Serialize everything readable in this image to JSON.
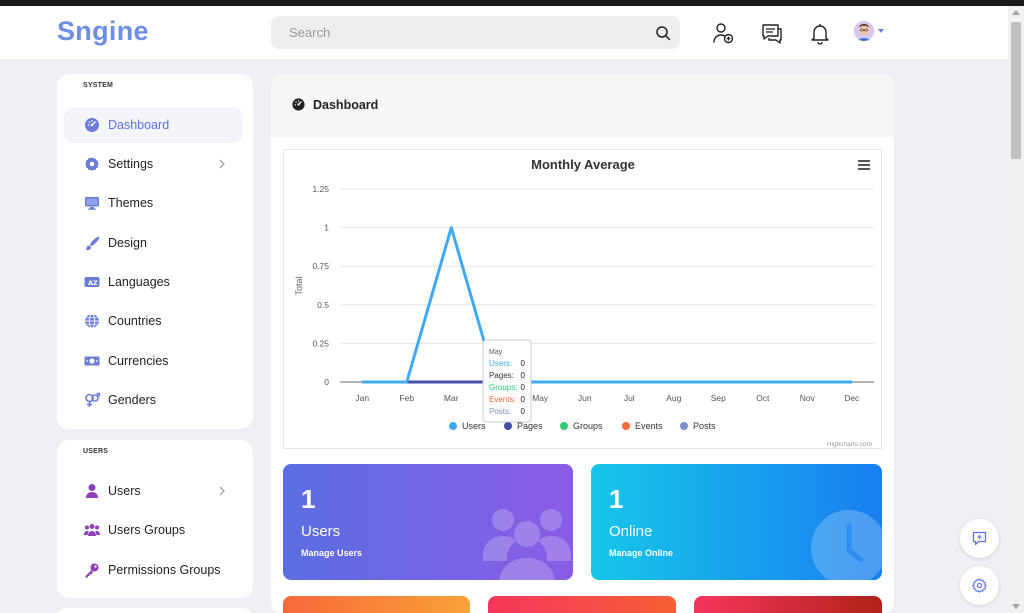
{
  "app": {
    "logo": "Sngine"
  },
  "header": {
    "search_placeholder": "Search",
    "icons": [
      "add-friend-icon",
      "messages-icon",
      "notifications-icon",
      "avatar"
    ]
  },
  "sidebar": {
    "system": {
      "title": "SYSTEM",
      "items": [
        {
          "label": "Dashboard",
          "icon": "dashboard-icon",
          "active": true
        },
        {
          "label": "Settings",
          "icon": "gear-icon",
          "has_submenu": true
        },
        {
          "label": "Themes",
          "icon": "monitor-icon"
        },
        {
          "label": "Design",
          "icon": "brush-icon"
        },
        {
          "label": "Languages",
          "icon": "language-icon"
        },
        {
          "label": "Countries",
          "icon": "globe-icon"
        },
        {
          "label": "Currencies",
          "icon": "money-icon"
        },
        {
          "label": "Genders",
          "icon": "gender-icon"
        }
      ]
    },
    "users": {
      "title": "USERS",
      "items": [
        {
          "label": "Users",
          "icon": "user-icon",
          "has_submenu": true
        },
        {
          "label": "Users Groups",
          "icon": "users-group-icon"
        },
        {
          "label": "Permissions Groups",
          "icon": "key-icon"
        }
      ]
    }
  },
  "main": {
    "title": "Dashboard",
    "stats": [
      {
        "value": "1",
        "title": "Users",
        "subtitle": "Manage Users"
      },
      {
        "value": "1",
        "title": "Online",
        "subtitle": "Manage Online"
      }
    ]
  },
  "chart_data": {
    "type": "line",
    "title": "Monthly Average",
    "ylabel": "Total",
    "xlabel": "",
    "categories": [
      "Jan",
      "Feb",
      "Mar",
      "Apr",
      "May",
      "Jun",
      "Jul",
      "Aug",
      "Sep",
      "Oct",
      "Nov",
      "Dec"
    ],
    "yticks": [
      "0",
      "0.25",
      "0.5",
      "0.75",
      "1",
      "1.25"
    ],
    "ylim": [
      0,
      1.25
    ],
    "grid": true,
    "legend_position": "bottom",
    "series": [
      {
        "name": "Users",
        "color": "#3fa9f5",
        "values": [
          0,
          0,
          1,
          0,
          0,
          0,
          0,
          0,
          0,
          0,
          0,
          0
        ]
      },
      {
        "name": "Pages",
        "color": "#434fa8",
        "values": [
          0,
          0,
          0,
          0,
          0,
          0,
          0,
          0,
          0,
          0,
          0,
          0
        ]
      },
      {
        "name": "Groups",
        "color": "#2ecc71",
        "values": [
          0,
          0,
          0,
          0,
          0,
          0,
          0,
          0,
          0,
          0,
          0,
          0
        ]
      },
      {
        "name": "Events",
        "color": "#f36b38",
        "values": [
          0,
          0,
          0,
          0,
          0,
          0,
          0,
          0,
          0,
          0,
          0,
          0
        ]
      },
      {
        "name": "Posts",
        "color": "#7b8fc9",
        "values": [
          0,
          0,
          0,
          0,
          0,
          0,
          0,
          0,
          0,
          0,
          0,
          0
        ]
      }
    ],
    "tooltip": {
      "month": "May",
      "rows": [
        {
          "label": "Users:",
          "value": "0",
          "color": "#3fa9f5"
        },
        {
          "label": "Pages:",
          "value": "0",
          "color": "#333333"
        },
        {
          "label": "Groups:",
          "value": "0",
          "color": "#2ecc71"
        },
        {
          "label": "Events:",
          "value": "0",
          "color": "#f36b38"
        },
        {
          "label": "Posts:",
          "value": "0",
          "color": "#7b8fc9"
        }
      ]
    },
    "credits": "Highcharts.com"
  },
  "colors": {
    "accent": "#5e72e4",
    "logo": "#6c8ee3",
    "users_card_gradient": [
      "#5b6ee1",
      "#8a5ce6"
    ],
    "online_card_gradient": [
      "#17c6e8",
      "#1a7ef0"
    ]
  }
}
